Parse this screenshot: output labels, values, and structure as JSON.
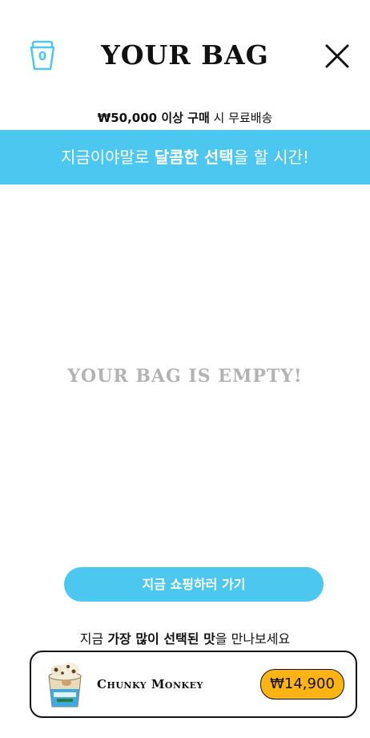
{
  "header": {
    "bag_count": "0",
    "title": "YOUR BAG"
  },
  "shipping": {
    "strong": "₩50,000 이상 구매",
    "rest": " 시 무료배송"
  },
  "banner": {
    "pre": "지금이야말로 ",
    "strong": "달콤한 선택",
    "post": "을 할 시간!"
  },
  "empty_message": "YOUR BAG IS EMPTY!",
  "shop_button_label": "지금 쇼핑하러 가기",
  "popular": {
    "pre": "지금 ",
    "strong": "가장 많이 선택된 맛",
    "post": "을 만나보세요"
  },
  "product": {
    "name": "Chunky Monkey",
    "price": "₩14,900"
  },
  "colors": {
    "accent": "#4cc8f0",
    "price_badge": "#fbb413",
    "empty_text": "#b3b3b3"
  }
}
